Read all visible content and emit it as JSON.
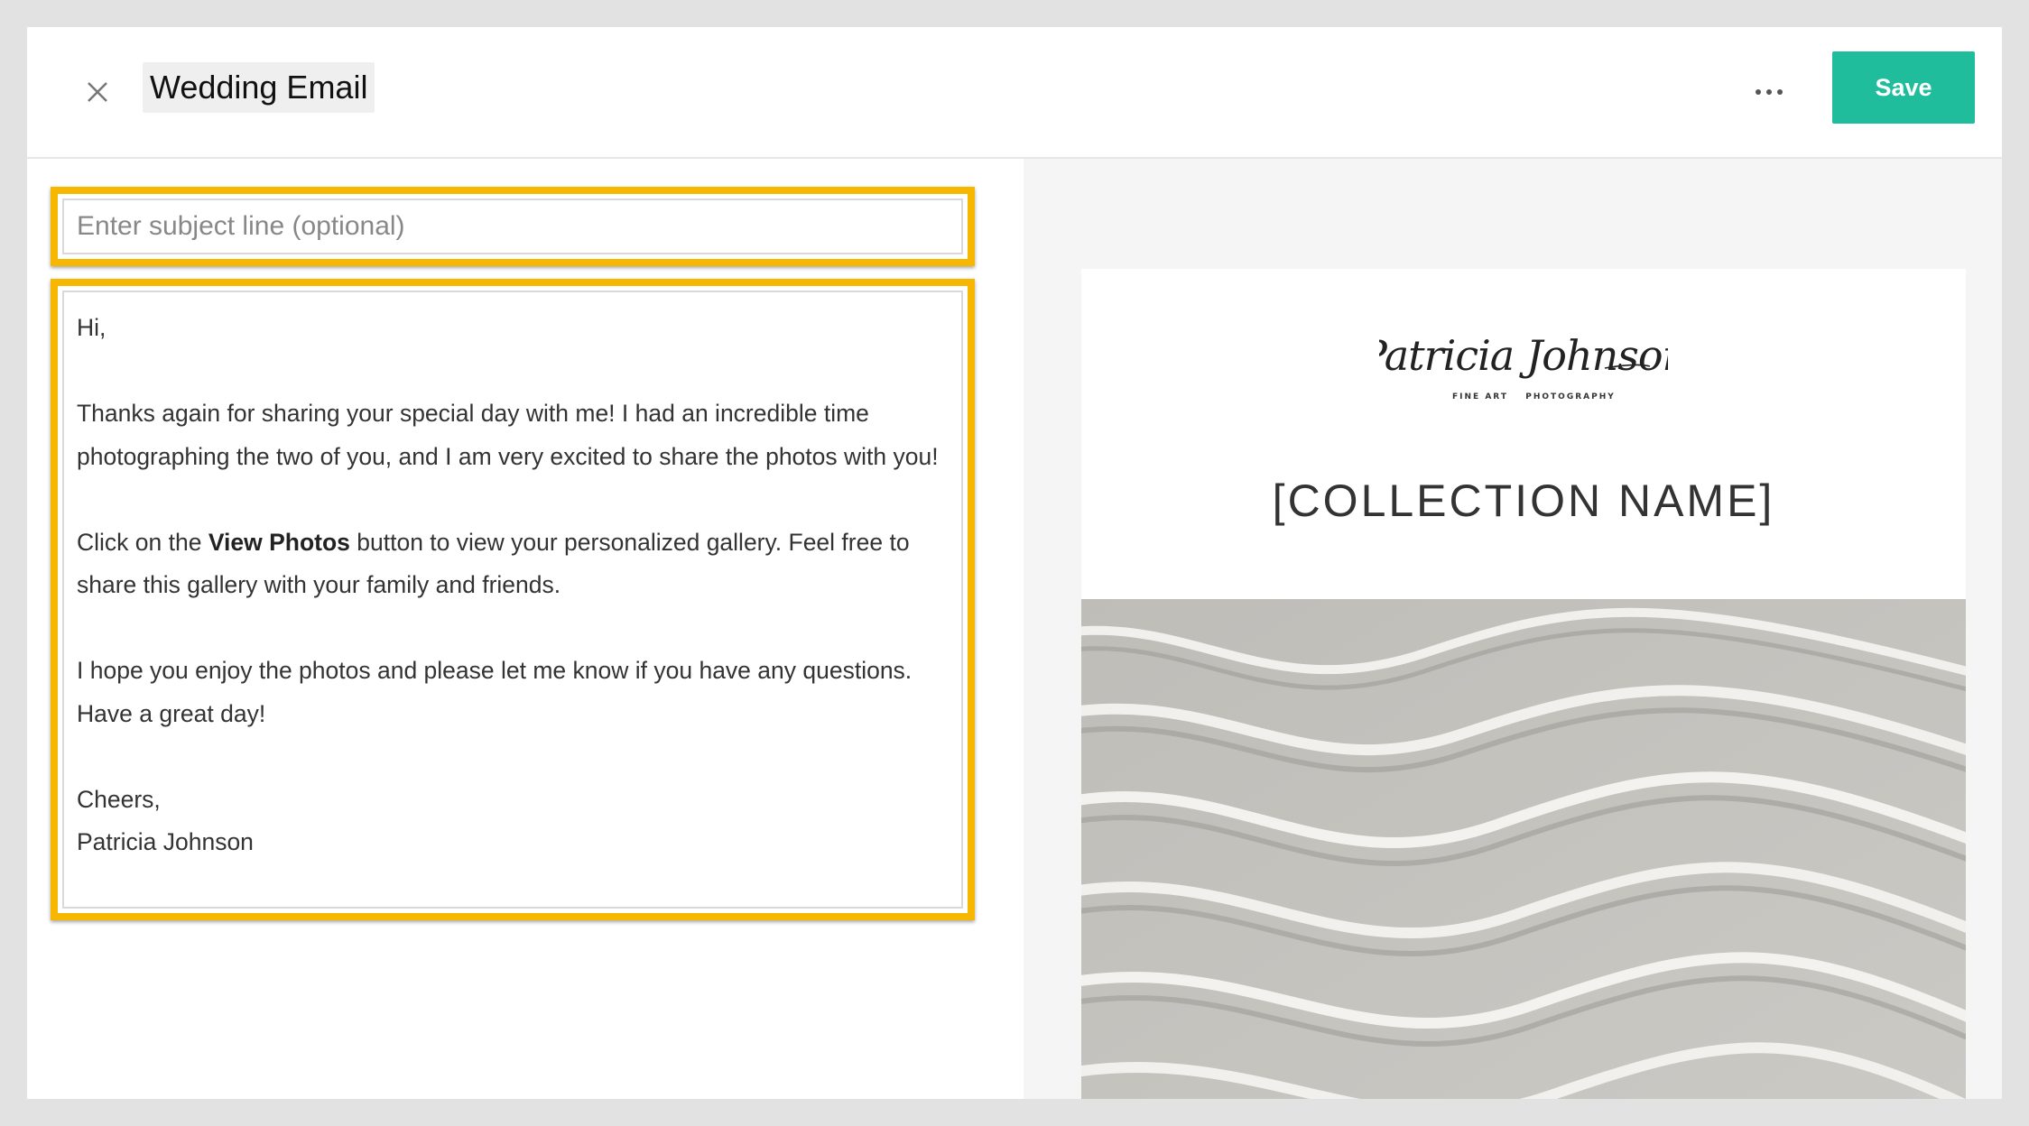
{
  "header": {
    "title": "Wedding Email",
    "save_label": "Save",
    "close_icon": "close-icon",
    "more_icon": "more-horizontal-icon"
  },
  "subject": {
    "placeholder": "Enter subject line (optional)",
    "value": ""
  },
  "body": {
    "greeting": "Hi,",
    "paragraph1": "Thanks again for sharing your special day with me! I had an incredible time photographing the two of you, and I am very excited to share the photos with you!",
    "paragraph2_before": "Click on the ",
    "paragraph2_bold": "View Photos",
    "paragraph2_after": " button to view your personalized gallery. Feel free to share this gallery with your family and friends.",
    "paragraph3": "I hope you enjoy the photos and please let me know if you have any questions. Have a great day!",
    "closing": "Cheers,",
    "signature": "Patricia Johnson"
  },
  "preview": {
    "logo_name": "Patricia Johnson",
    "logo_left": "FINE ART",
    "logo_right": "PHOTOGRAPHY",
    "collection_name": "[COLLECTION NAME]",
    "hero_image": "sand-dunes-image"
  },
  "colors": {
    "accent": "#20bd9c",
    "highlight": "#f7b600",
    "preview_bg": "#f5f5f5"
  }
}
